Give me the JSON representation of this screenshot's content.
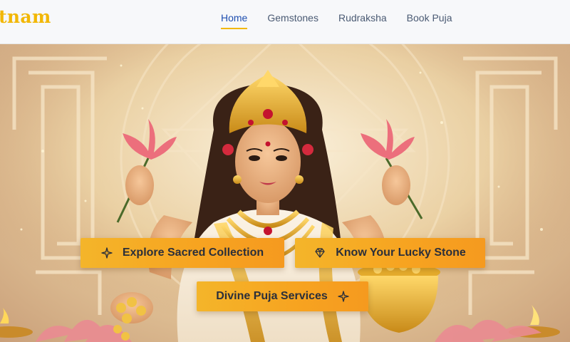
{
  "header": {
    "logo_text": "tnam",
    "nav": [
      {
        "label": "Home",
        "active": true
      },
      {
        "label": "Gemstones",
        "active": false
      },
      {
        "label": "Rudraksha",
        "active": false
      },
      {
        "label": "Book Puja",
        "active": false
      }
    ]
  },
  "hero": {
    "image_subject": "goddess-lakshmi-illustration",
    "buttons": {
      "explore": {
        "label": "Explore Sacred Collection",
        "icon": "sparkle-icon"
      },
      "lucky_stone": {
        "label": "Know Your Lucky Stone",
        "icon": "diamond-icon"
      },
      "puja": {
        "label": "Divine Puja Services",
        "icon": "sparkle-icon"
      }
    }
  },
  "colors": {
    "accent_gold": "#f2b705",
    "nav_text": "#4a5a73",
    "nav_active": "#1f4fb0",
    "button_gradient_start": "#f4b52a",
    "button_gradient_end": "#f59a1f"
  }
}
